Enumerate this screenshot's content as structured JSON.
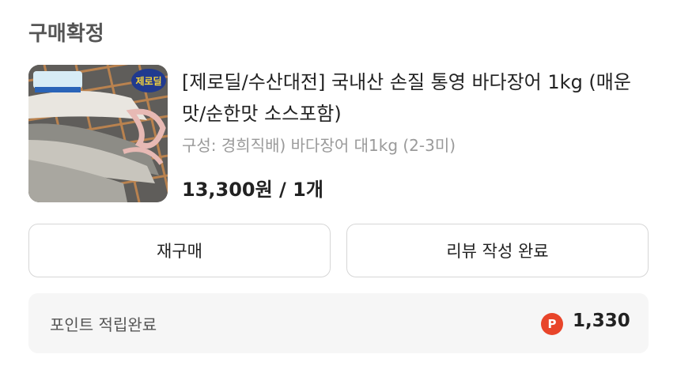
{
  "order": {
    "status": "구매확정",
    "product": {
      "title": "[제로딜/수산대전] 국내산 손질 통영 바다장어 1kg (매운맛/순한맛 소스포함)",
      "option": "구성: 경희직배) 바다장어 대1kg (2-3미)",
      "price": "13,300원 / 1개",
      "image_badge": "제로딜"
    },
    "buttons": {
      "rebuy": "재구매",
      "review": "리뷰 작성 완료"
    },
    "points": {
      "label": "포인트 적립완료",
      "icon": "P",
      "value": "1,330",
      "icon_color": "#e8452a"
    }
  }
}
